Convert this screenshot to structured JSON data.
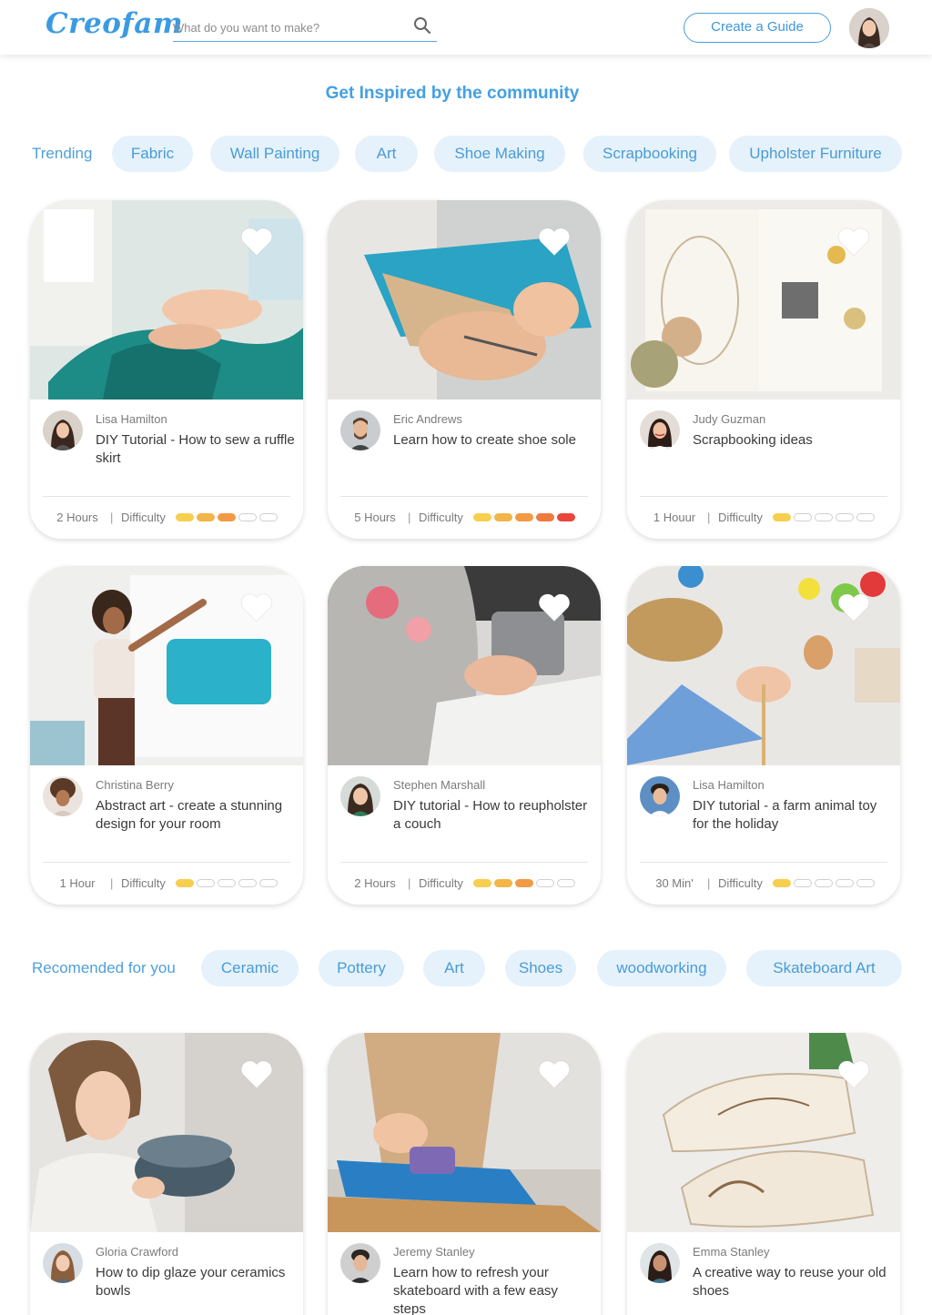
{
  "header": {
    "logo": "Creofam",
    "search_placeholder": "What do you want to make?",
    "create_button": "Create a Guide"
  },
  "main": {
    "title": "Get Inspired by the community"
  },
  "trending": {
    "label": "Trending",
    "chips": [
      "Fabric",
      "Wall Painting",
      "Art",
      "Shoe Making",
      "Scrapbooking",
      "Upholster Furniture"
    ]
  },
  "recommended": {
    "label": "Recomended for you",
    "chips": [
      "Ceramic",
      "Pottery",
      "Art",
      "Shoes",
      "woodworking",
      "Skateboard Art"
    ]
  },
  "difficulty_label": "Difficulty",
  "difficulty_colors": [
    "#f6cf4e",
    "#f3b448",
    "#f29a44",
    "#ef7a40",
    "#e9473e"
  ],
  "cards": [
    {
      "author": "Lisa Hamilton",
      "title": "DIY Tutorial - How to sew a ruffle skirt",
      "duration": "2 Hours",
      "difficulty": 3
    },
    {
      "author": "Eric Andrews",
      "title": "Learn how to create shoe sole",
      "duration": "5 Hours",
      "difficulty": 5
    },
    {
      "author": "Judy Guzman",
      "title": "Scrapbooking ideas",
      "duration": "1 Houur",
      "difficulty": 1
    },
    {
      "author": "Christina Berry",
      "title": "Abstract art - create a stunning design for your room",
      "duration": "1 Hour",
      "difficulty": 1
    },
    {
      "author": "Stephen Marshall",
      "title": "DIY tutorial - How to reupholster a couch",
      "duration": "2 Hours",
      "difficulty": 3
    },
    {
      "author": "Lisa Hamilton",
      "title": "DIY tutorial - a farm animal toy for the holiday",
      "duration": "30 Min'",
      "difficulty": 1
    },
    {
      "author": "Gloria Crawford",
      "title": "How to dip glaze your ceramics bowls",
      "duration": "",
      "difficulty": 0
    },
    {
      "author": "Jeremy Stanley",
      "title": "Learn how to refresh your skateboard with a few easy steps",
      "duration": "",
      "difficulty": 0
    },
    {
      "author": "Emma Stanley",
      "title": "A creative way to reuse your old shoes",
      "duration": "",
      "difficulty": 0
    }
  ]
}
